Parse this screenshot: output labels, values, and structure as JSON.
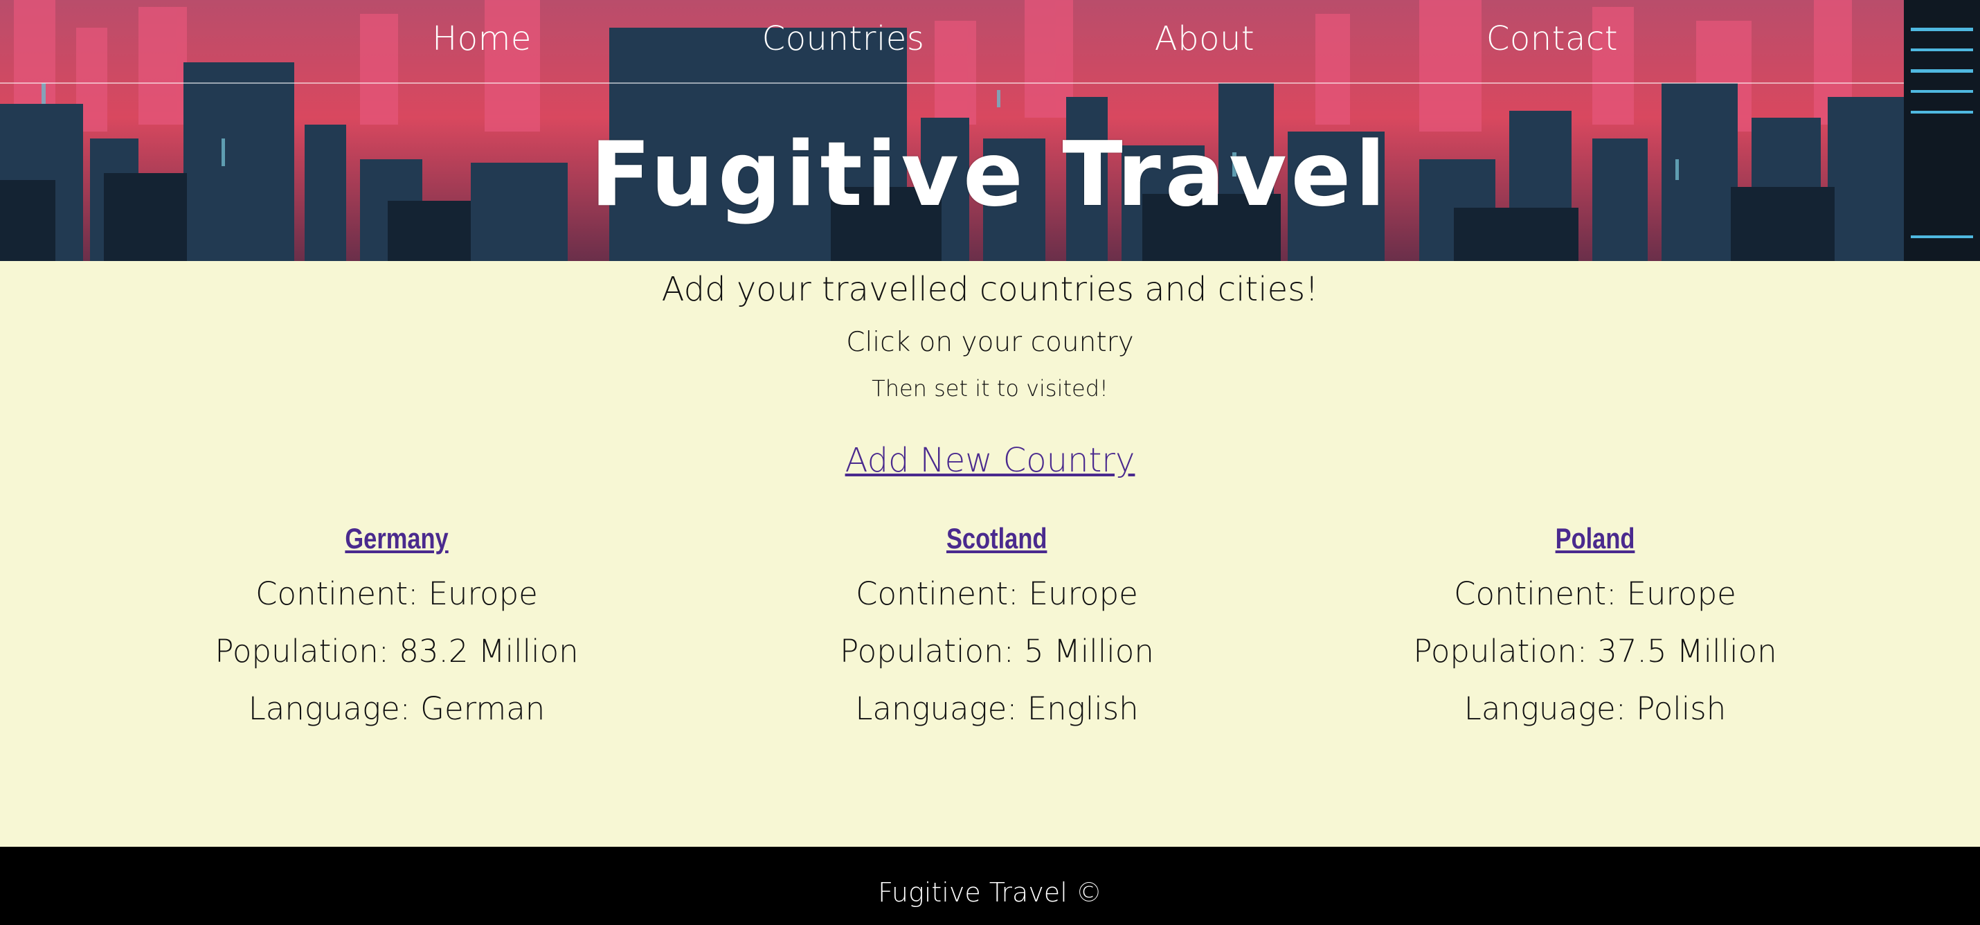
{
  "nav": {
    "items": [
      {
        "label": "Home"
      },
      {
        "label": "Countries"
      },
      {
        "label": "About"
      },
      {
        "label": "Contact"
      }
    ]
  },
  "header": {
    "title": "Fugitive Travel"
  },
  "main": {
    "heading": "Add your travelled countries and cities!",
    "subheading": "Click on your country",
    "note": "Then set it to visited!",
    "add_link": "Add New Country",
    "countries": [
      {
        "name": "Germany",
        "continent": "Continent: Europe",
        "population": "Population: 83.2 Million",
        "language": "Language: German"
      },
      {
        "name": "Scotland",
        "continent": "Continent: Europe",
        "population": "Population: 5 Million",
        "language": "Language: English"
      },
      {
        "name": "Poland",
        "continent": "Continent: Europe",
        "population": "Population: 37.5 Million",
        "language": "Language: Polish"
      }
    ]
  },
  "footer": {
    "text": "Fugitive Travel ©"
  },
  "colors": {
    "page_background": "#f7f7d4",
    "link": "#4a2a8e",
    "footer_background": "#000000",
    "header_pink": "#d94b6a",
    "header_dark": "#1b2a3a"
  }
}
